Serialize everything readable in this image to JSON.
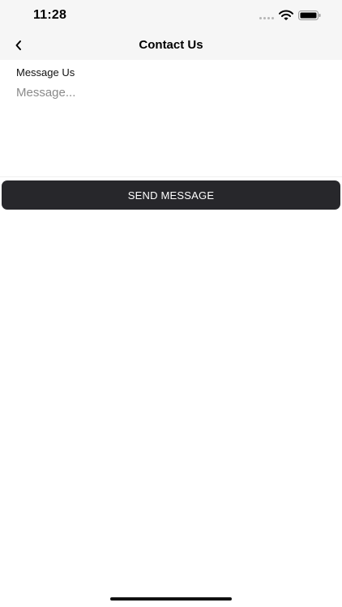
{
  "status_bar": {
    "time": "11:28",
    "icons": [
      "signal-icon",
      "wifi-icon",
      "battery-icon"
    ]
  },
  "nav": {
    "title": "Contact Us",
    "back_icon": "chevron-left-icon"
  },
  "form": {
    "label": "Message Us",
    "message_placeholder": "Message...",
    "message_value": "",
    "submit_label": "SEND MESSAGE"
  },
  "colors": {
    "bar_background": "#f6f6f6",
    "button_background": "#27272b",
    "button_text": "#ffffff",
    "placeholder": "#8a8a8a"
  }
}
